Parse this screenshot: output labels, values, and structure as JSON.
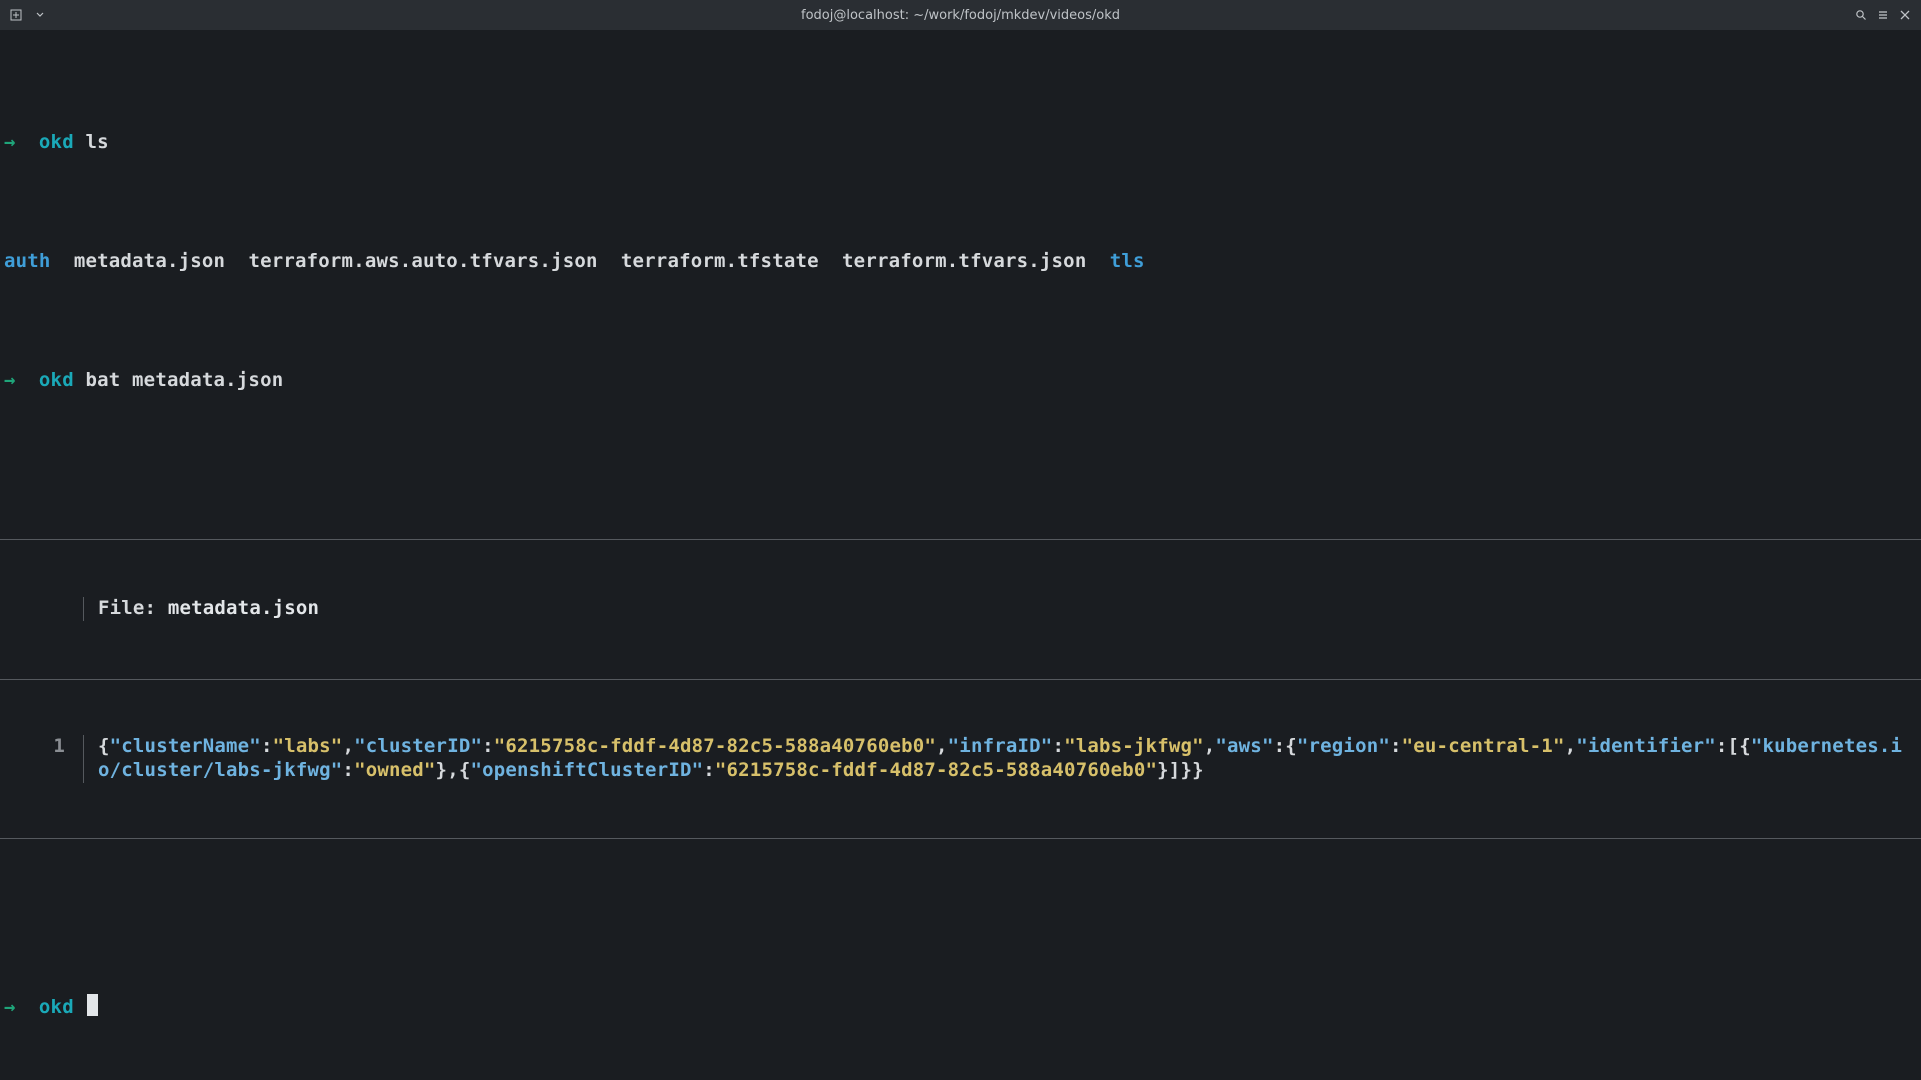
{
  "titlebar": {
    "title": "fodoj@localhost: ~/work/fodoj/mkdev/videos/okd"
  },
  "prompt": {
    "arrow": "→",
    "dir": "okd"
  },
  "cmd1": "ls",
  "ls_output": {
    "auth": "auth",
    "metadata": "metadata.json",
    "tfvars_auto": "terraform.aws.auto.tfvars.json",
    "tfstate": "terraform.tfstate",
    "tfvars": "terraform.tfvars.json",
    "tls": "tls"
  },
  "cmd2": "bat metadata.json",
  "bat": {
    "file_label": "File: ",
    "file_name": "metadata.json",
    "line_no": "1"
  },
  "json": {
    "k_clusterName": "\"clusterName\"",
    "v_clusterName": "\"labs\"",
    "k_clusterID": "\"clusterID\"",
    "v_clusterID": "\"6215758c-fddf-4d87-82c5-588a40760eb0\"",
    "k_infraID": "\"infraID\"",
    "v_infraID": "\"labs-jkfwg\"",
    "k_aws": "\"aws\"",
    "k_region": "\"region\"",
    "v_region": "\"eu-central-1\"",
    "k_identifier": "\"identifier\"",
    "k_kubeTag": "\"kubernetes.io/cluster/labs-jkfwg\"",
    "v_kubeTag": "\"owned\"",
    "k_osClusterID": "\"openshiftClusterID\"",
    "v_osClusterID": "\"6215758c-fddf-4d87-82c5-588a40760eb0\""
  },
  "p": {
    "ob": "{",
    "cb": "}",
    "osb": "[",
    "csb": "]",
    "colon": ":",
    "comma": ",",
    "close_all": "}]}}"
  }
}
